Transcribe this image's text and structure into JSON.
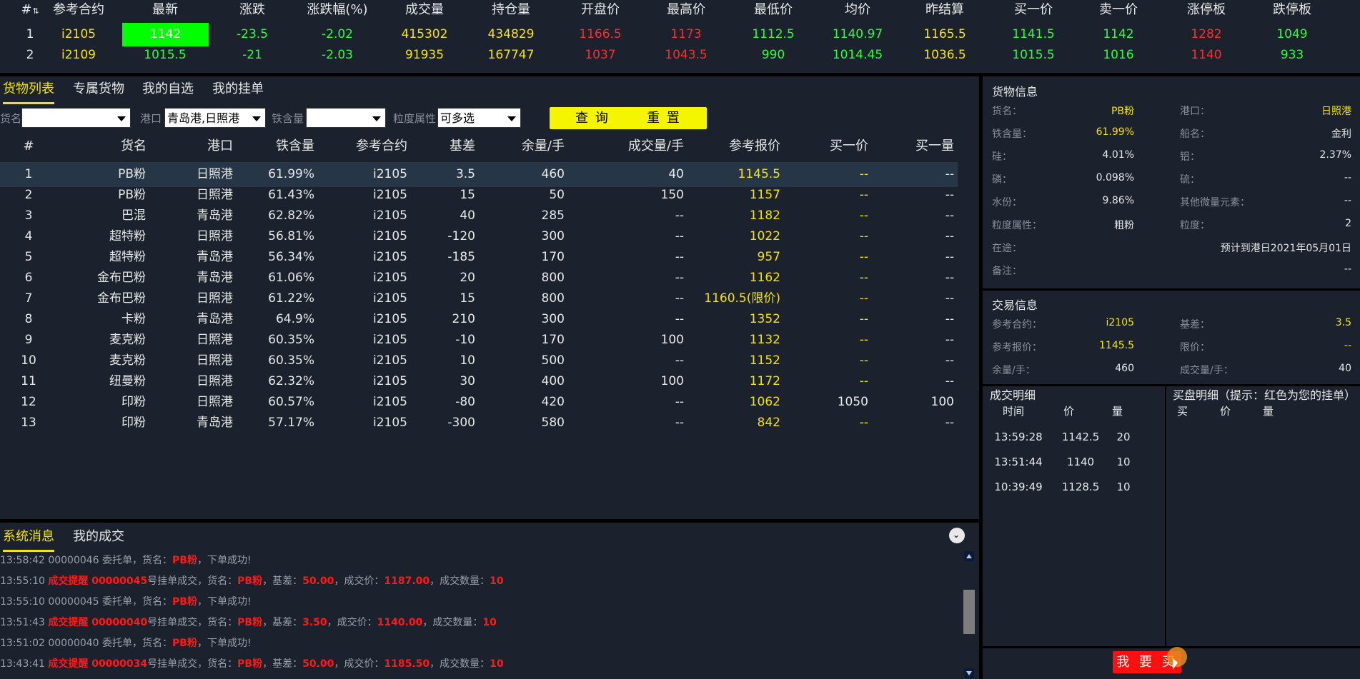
{
  "colors": {
    "up": "#ff2b2b",
    "down": "#2bff3a",
    "neutral": "#f5e400",
    "highlight_cell": "#00ff00",
    "accent_yellow": "#f5e400"
  },
  "quote": {
    "headers": [
      "#",
      "参考合约",
      "最新",
      "涨跌",
      "涨跌幅(%)",
      "成交量",
      "持仓量",
      "开盘价",
      "最高价",
      "最低价",
      "均价",
      "昨结算",
      "买一价",
      "卖一价",
      "涨停板",
      "跌停板"
    ],
    "sort_icon": "sort-icon",
    "rows": [
      [
        "1",
        "i2105",
        "1142",
        "-23.5",
        "-2.02",
        "415302",
        "434829",
        "1166.5",
        "1173",
        "1112.5",
        "1140.97",
        "1165.5",
        "1141.5",
        "1142",
        "1282",
        "1049"
      ],
      [
        "2",
        "i2109",
        "1015.5",
        "-21",
        "-2.03",
        "91935",
        "167747",
        "1037",
        "1043.5",
        "990",
        "1014.45",
        "1036.5",
        "1015.5",
        "1016",
        "1140",
        "933"
      ]
    ]
  },
  "left": {
    "tabs": [
      "货物列表",
      "专属货物",
      "我的自选",
      "我的挂单"
    ],
    "filters": {
      "name_label": "货名",
      "name_value": "",
      "port_label": "港口",
      "port_value": "青岛港,日照港",
      "iron_label": "铁含量",
      "iron_value": "",
      "granularity_label": "粒度属性",
      "granularity_value": "可多选"
    },
    "query_label": "查 询",
    "reset_label": "重 置",
    "table_headers": [
      "#",
      "货名",
      "港口",
      "铁含量",
      "参考合约",
      "基差",
      "余量/手",
      "成交量/手",
      "参考报价",
      "买一价",
      "买一量"
    ],
    "rows": [
      [
        "1",
        "PB粉",
        "日照港",
        "61.99%",
        "i2105",
        "3.5",
        "460",
        "40",
        "1145.5",
        "--",
        "--"
      ],
      [
        "2",
        "PB粉",
        "日照港",
        "61.43%",
        "i2105",
        "15",
        "50",
        "150",
        "1157",
        "--",
        "--"
      ],
      [
        "3",
        "巴混",
        "青岛港",
        "62.82%",
        "i2105",
        "40",
        "285",
        "--",
        "1182",
        "--",
        "--"
      ],
      [
        "4",
        "超特粉",
        "日照港",
        "56.81%",
        "i2105",
        "-120",
        "300",
        "--",
        "1022",
        "--",
        "--"
      ],
      [
        "5",
        "超特粉",
        "青岛港",
        "56.34%",
        "i2105",
        "-185",
        "170",
        "--",
        "957",
        "--",
        "--"
      ],
      [
        "6",
        "金布巴粉",
        "青岛港",
        "61.06%",
        "i2105",
        "20",
        "800",
        "--",
        "1162",
        "--",
        "--"
      ],
      [
        "7",
        "金布巴粉",
        "日照港",
        "61.22%",
        "i2105",
        "15",
        "800",
        "--",
        "1160.5(限价)",
        "--",
        "--"
      ],
      [
        "8",
        "卡粉",
        "青岛港",
        "64.9%",
        "i2105",
        "210",
        "300",
        "--",
        "1352",
        "--",
        "--"
      ],
      [
        "9",
        "麦克粉",
        "日照港",
        "60.35%",
        "i2105",
        "-10",
        "170",
        "100",
        "1132",
        "--",
        "--"
      ],
      [
        "10",
        "麦克粉",
        "日照港",
        "60.35%",
        "i2105",
        "10",
        "500",
        "--",
        "1152",
        "--",
        "--"
      ],
      [
        "11",
        "纽曼粉",
        "日照港",
        "62.32%",
        "i2105",
        "30",
        "400",
        "100",
        "1172",
        "--",
        "--"
      ],
      [
        "12",
        "印粉",
        "日照港",
        "60.57%",
        "i2105",
        "-80",
        "420",
        "--",
        "1062",
        "1050",
        "100"
      ],
      [
        "13",
        "印粉",
        "青岛港",
        "57.17%",
        "i2105",
        "-300",
        "580",
        "--",
        "842",
        "--",
        "--"
      ]
    ]
  },
  "messages": {
    "tabs": [
      "系统消息",
      "我的成交"
    ],
    "collapse_icon": "chevron-double-down-icon",
    "items": [
      [
        [
          "13:58:42 00000046 委托单，货名：",
          false
        ],
        [
          "PB粉",
          true
        ],
        [
          "，下单成功!",
          false
        ]
      ],
      [
        [
          "13:55:10 ",
          false
        ],
        [
          "成交提醒 00000045",
          true
        ],
        [
          "号挂单成交，货名：",
          false
        ],
        [
          "PB粉",
          true
        ],
        [
          "，基差：",
          false
        ],
        [
          "50.00",
          true
        ],
        [
          "，成交价：",
          false
        ],
        [
          "1187.00",
          true
        ],
        [
          "，成交数量：",
          false
        ],
        [
          "10",
          true
        ]
      ],
      [
        [
          "13:55:10 00000045 委托单，货名：",
          false
        ],
        [
          "PB粉",
          true
        ],
        [
          "，下单成功!",
          false
        ]
      ],
      [
        [
          "13:51:43 ",
          false
        ],
        [
          "成交提醒 00000040",
          true
        ],
        [
          "号挂单成交，货名：",
          false
        ],
        [
          "PB粉",
          true
        ],
        [
          "，基差：",
          false
        ],
        [
          "3.50",
          true
        ],
        [
          "，成交价：",
          false
        ],
        [
          "1140.00",
          true
        ],
        [
          "，成交数量：",
          false
        ],
        [
          "10",
          true
        ]
      ],
      [
        [
          "13:51:02 00000040 委托单，货名：",
          false
        ],
        [
          "PB粉",
          true
        ],
        [
          "，下单成功!",
          false
        ]
      ],
      [
        [
          "13:43:41 ",
          false
        ],
        [
          "成交提醒 00000034",
          true
        ],
        [
          "号挂单成交，货名：",
          false
        ],
        [
          "PB粉",
          true
        ],
        [
          "，基差：",
          false
        ],
        [
          "50.00",
          true
        ],
        [
          "，成交价：",
          false
        ],
        [
          "1185.50",
          true
        ],
        [
          "，成交数量：",
          false
        ],
        [
          "10",
          true
        ]
      ]
    ]
  },
  "goods_info": {
    "title": "货物信息",
    "name_label": "货名：",
    "name": "PB粉",
    "port_label": "港口：",
    "port": "日照港",
    "iron_label": "铁含量：",
    "iron": "61.99%",
    "ship_label": "船名：",
    "ship": "金利",
    "si_label": "硅：",
    "si": "4.01%",
    "al_label": "铝：",
    "al": "2.37%",
    "p_label": "磷：",
    "p": "0.098%",
    "s_label": "硫：",
    "s": "--",
    "water_label": "水份：",
    "water": "9.86%",
    "trace_label": "其他微量元素：",
    "trace": "--",
    "gran_attr_label": "粒度属性：",
    "gran_attr": "粗粉",
    "gran_label": "粒度：",
    "gran": "2",
    "transit_label": "在途：",
    "transit": "预计到港日2021年05月01日",
    "remark_label": "备注：",
    "remark": "--"
  },
  "trade_info": {
    "title": "交易信息",
    "contract_label": "参考合约：",
    "contract": "i2105",
    "basis_label": "基差：",
    "basis": "3.5",
    "quote_label": "参考报价：",
    "quote": "1145.5",
    "limit_label": "限价：",
    "limit": "--",
    "remain_label": "余量/手：",
    "remain": "460",
    "volume_label": "成交量/手：",
    "volume": "40"
  },
  "deal_detail": {
    "title": "成交明细",
    "headers": [
      "时间",
      "价",
      "量"
    ],
    "rows": [
      [
        "13:59:28",
        "1142.5",
        "20"
      ],
      [
        "13:51:44",
        "1140",
        "10"
      ],
      [
        "10:39:49",
        "1128.5",
        "10"
      ]
    ]
  },
  "buy_detail": {
    "title": "买盘明细（提示：红色为您的挂单）",
    "headers": [
      "买",
      "价",
      "量"
    ]
  },
  "buy_button": "我 要 买"
}
